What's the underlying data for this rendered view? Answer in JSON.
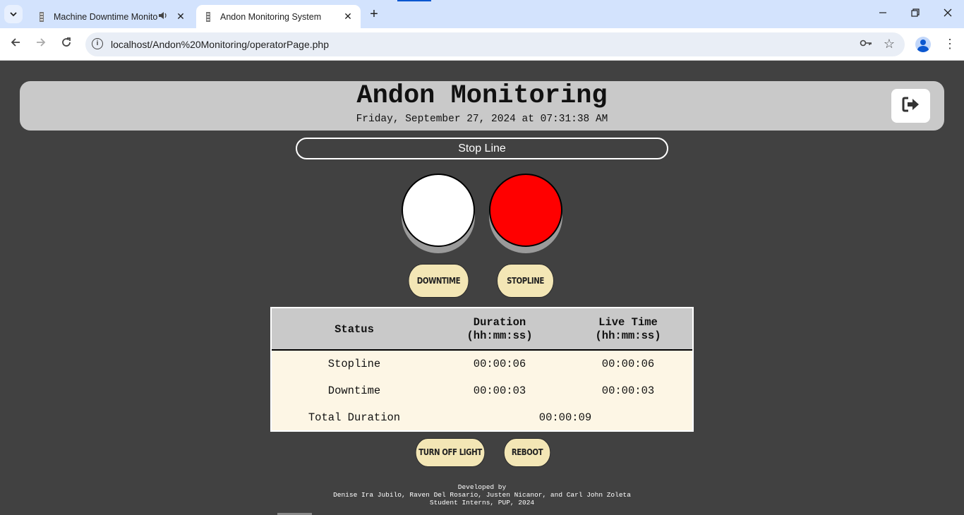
{
  "browser": {
    "tabs": [
      {
        "title": "Machine Downtime Monitoring",
        "active": false,
        "audio": true
      },
      {
        "title": "Andon Monitoring System",
        "active": true,
        "audio": false
      }
    ],
    "url": "localhost/Andon%20Monitoring/operatorPage.php",
    "icons": {
      "tab_search": "chevron-down-icon",
      "new_tab": "plus-icon",
      "minimize": "minimize-icon",
      "restore": "restore-icon",
      "close": "close-icon",
      "back": "back-arrow-icon",
      "forward": "forward-arrow-icon",
      "reload": "reload-icon",
      "site_info": "info-icon",
      "password": "key-icon",
      "bookmark": "star-icon",
      "profile": "profile-icon",
      "menu": "kebab-menu-icon"
    }
  },
  "header": {
    "title": "Andon Monitoring",
    "datetime": "Friday, September 27, 2024 at 07:31:38 AM",
    "logout_icon": "logout-icon"
  },
  "status_bar": {
    "label": "Stop Line"
  },
  "lights": [
    {
      "name": "downtime-light",
      "color": "#ffffff"
    },
    {
      "name": "stopline-light",
      "color": "#ff0000"
    }
  ],
  "buttons": {
    "downtime": "DOWNTIME",
    "stopline": "STOPLINE",
    "turn_off_light": "TURN OFF LIGHT",
    "reboot": "REBOOT"
  },
  "table": {
    "headers": {
      "status": "Status",
      "duration": "Duration",
      "duration_unit": "(hh:mm:ss)",
      "live_time": "Live Time",
      "live_time_unit": "(hh:mm:ss)"
    },
    "rows": [
      {
        "status": "Stopline",
        "duration": "00:00:06",
        "live_time": "00:00:06"
      },
      {
        "status": "Downtime",
        "duration": "00:00:03",
        "live_time": "00:00:03"
      }
    ],
    "total": {
      "label": "Total Duration",
      "value": "00:00:09"
    }
  },
  "footer": {
    "line1": "Developed by",
    "line2": "Denise Ira Jubilo, Raven Del Rosario, Justen Nicanor, and Carl John Zoleta",
    "line3": "Student Interns, PUP, 2024"
  },
  "colors": {
    "page_bg": "#414141",
    "header_bg": "#c9c9c9",
    "button_bg": "#f3e6b5",
    "table_bg": "#fdf6e5",
    "alert_red": "#ff0000"
  }
}
